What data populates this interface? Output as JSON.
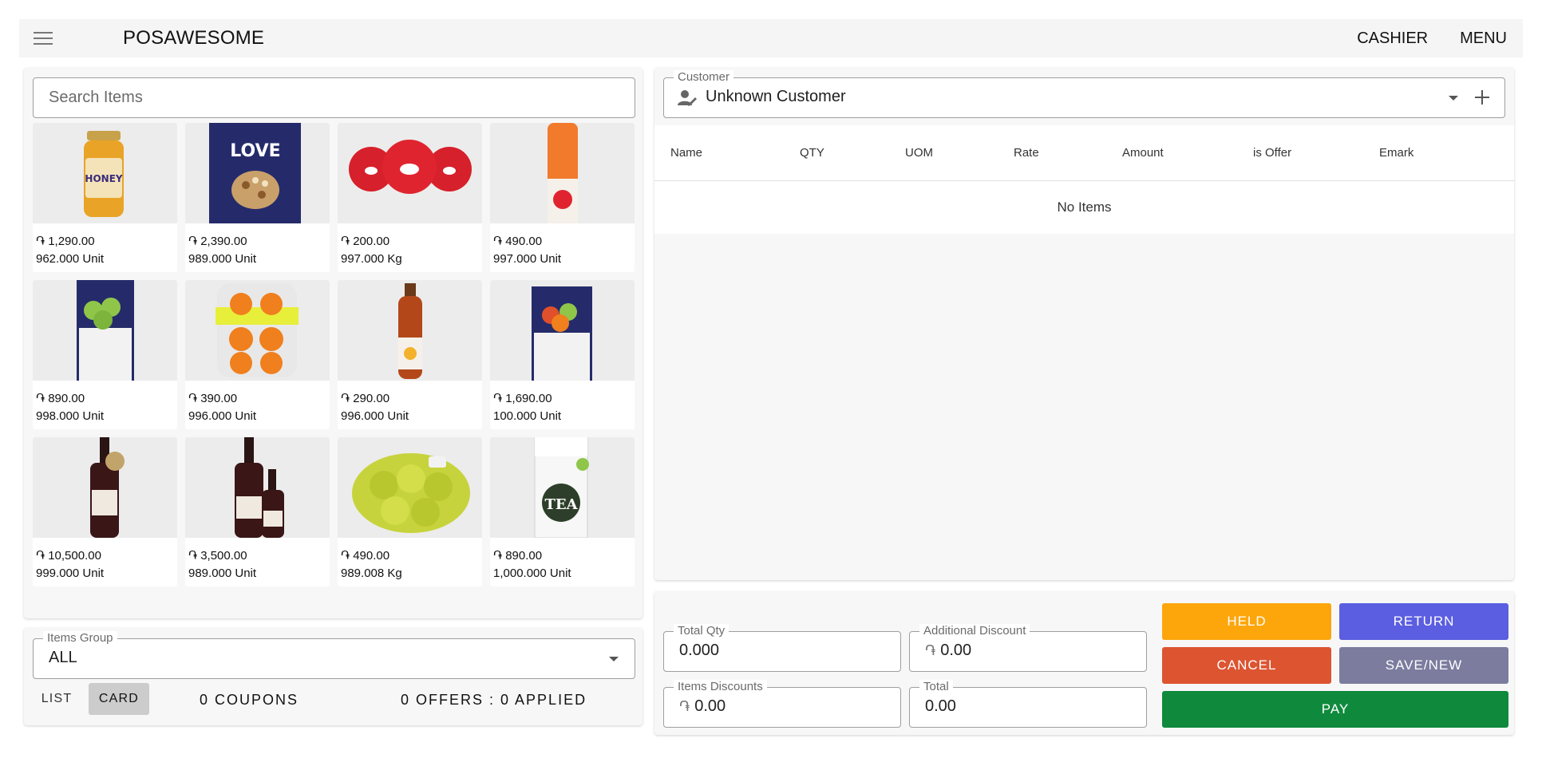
{
  "header": {
    "title": "POSAWESOME",
    "cashier_label": "CASHIER",
    "menu_label": "MENU"
  },
  "search": {
    "placeholder": "Search Items"
  },
  "currency_symbol": "֏",
  "items": [
    {
      "price": "1,290.00",
      "stock": "962.000 Unit"
    },
    {
      "price": "2,390.00",
      "stock": "989.000 Unit"
    },
    {
      "price": "200.00",
      "stock": "997.000 Kg"
    },
    {
      "price": "490.00",
      "stock": "997.000 Unit"
    },
    {
      "price": "890.00",
      "stock": "998.000 Unit"
    },
    {
      "price": "390.00",
      "stock": "996.000 Unit"
    },
    {
      "price": "290.00",
      "stock": "996.000 Unit"
    },
    {
      "price": "1,690.00",
      "stock": "100.000 Unit"
    },
    {
      "price": "10,500.00",
      "stock": "999.000 Unit"
    },
    {
      "price": "3,500.00",
      "stock": "989.000 Unit"
    },
    {
      "price": "490.00",
      "stock": "989.008 Kg"
    },
    {
      "price": "890.00",
      "stock": "1,000.000 Unit"
    }
  ],
  "items_group": {
    "label": "Items Group",
    "value": "ALL"
  },
  "view_toggle": {
    "list": "LIST",
    "card": "CARD"
  },
  "coupons_label": "0 COUPONS",
  "offers_label": "0 OFFERS : 0 APPLIED",
  "customer": {
    "label": "Customer",
    "value": "Unknown Customer"
  },
  "table": {
    "columns": [
      "Name",
      "QTY",
      "UOM",
      "Rate",
      "Amount",
      "is Offer",
      "Emark"
    ],
    "empty_text": "No Items"
  },
  "totals": {
    "total_qty_label": "Total Qty",
    "total_qty": "0.000",
    "additional_discount_label": "Additional Discount",
    "additional_discount": "0.00",
    "items_discounts_label": "Items Discounts",
    "items_discounts": "0.00",
    "total_label": "Total",
    "total": "0.00"
  },
  "actions": {
    "held": "HELD",
    "return": "RETURN",
    "cancel": "CANCEL",
    "save_new": "SAVE/NEW",
    "pay": "PAY"
  },
  "colors": {
    "held": "#fca60c",
    "return": "#5b5ee0",
    "cancel": "#dd5431",
    "save_new": "#7b7c9e",
    "pay": "#0f8a3c",
    "card_toggle": "#cccccc"
  }
}
